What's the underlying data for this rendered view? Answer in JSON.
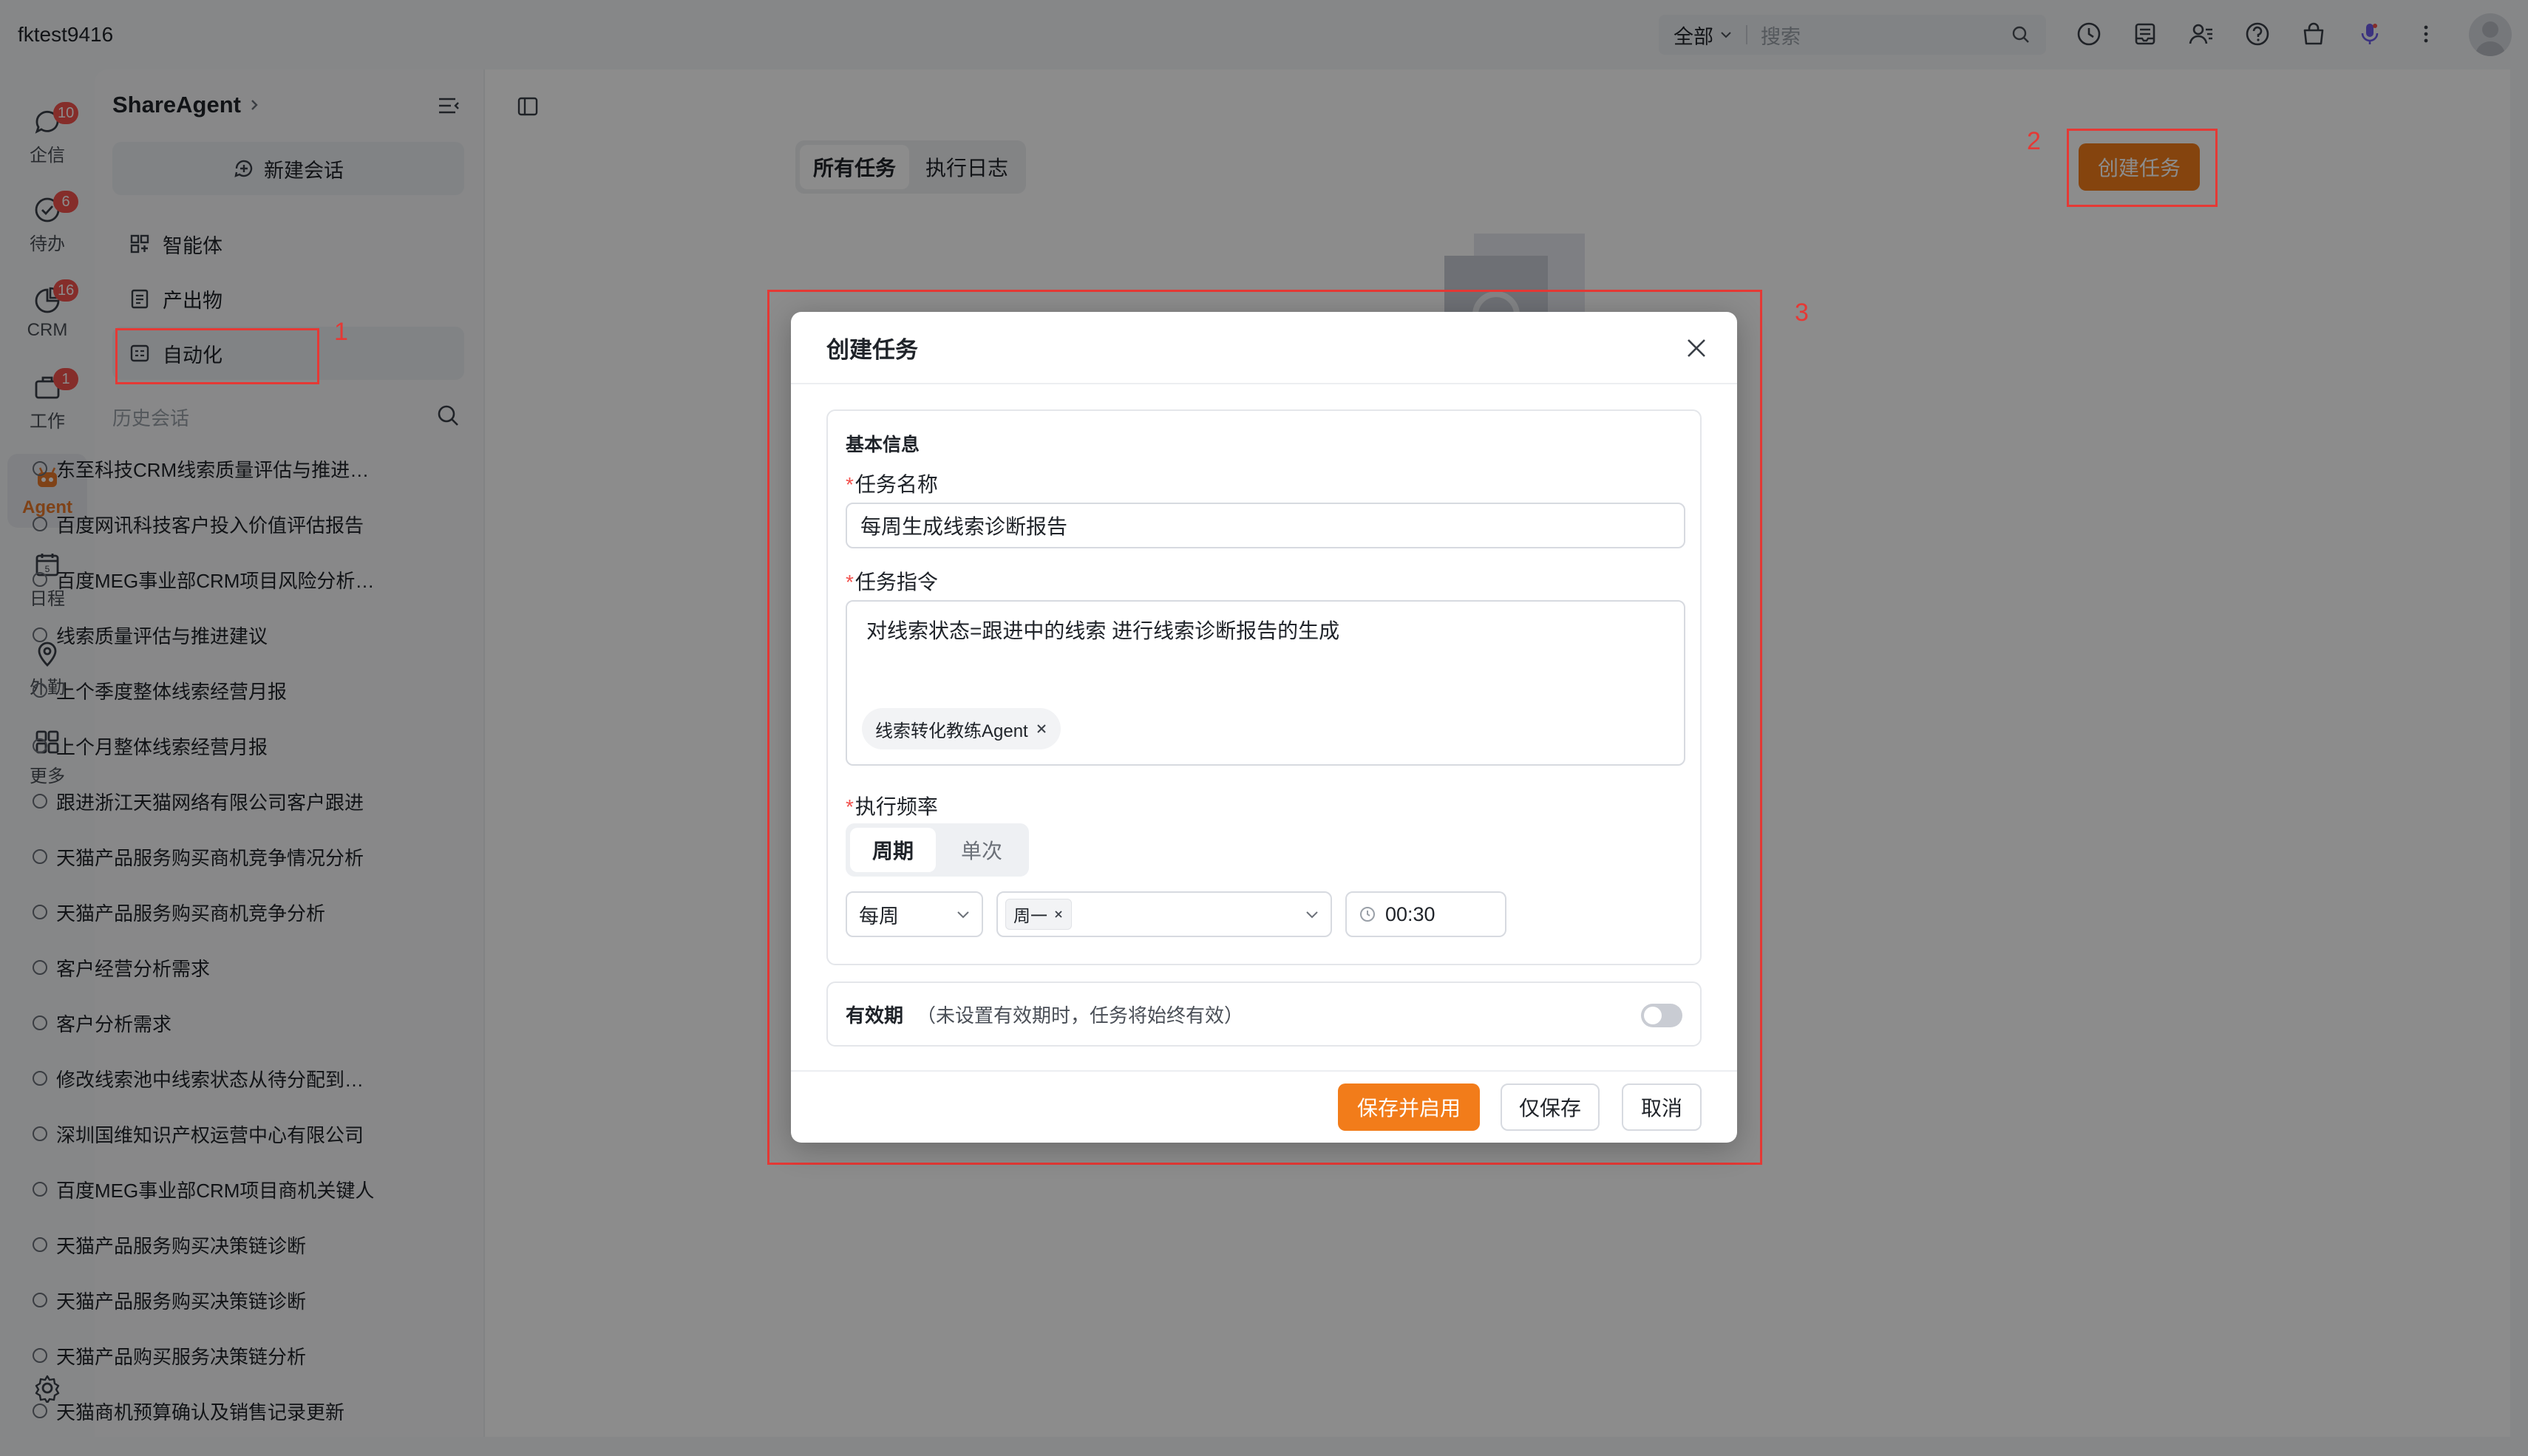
{
  "topbar": {
    "account": "fktest9416",
    "search_scope": "全部",
    "search_placeholder": "搜索"
  },
  "rail": {
    "items": [
      {
        "label": "企信",
        "badge": "10",
        "icon": "chat-icon"
      },
      {
        "label": "待办",
        "badge": "6",
        "icon": "check-circle-icon"
      },
      {
        "label": "CRM",
        "badge": "16",
        "icon": "pie-chart-icon"
      },
      {
        "label": "工作",
        "badge": "1",
        "icon": "briefcase-icon"
      },
      {
        "label": "Agent",
        "badge": "",
        "icon": "robot-icon"
      },
      {
        "label": "日程",
        "badge": "",
        "icon": "calendar-icon"
      },
      {
        "label": "外勤",
        "badge": "",
        "icon": "location-pin-icon"
      },
      {
        "label": "更多",
        "badge": "",
        "icon": "grid-icon"
      }
    ]
  },
  "sidebar": {
    "app_name": "ShareAgent",
    "new_chat": "新建会话",
    "nav": [
      {
        "label": "智能体",
        "icon": "agent-grid-icon"
      },
      {
        "label": "产出物",
        "icon": "document-icon"
      },
      {
        "label": "自动化",
        "icon": "automation-icon"
      }
    ],
    "history_title": "历史会话",
    "history": [
      "东至科技CRM线索质量评估与推进建议",
      "百度网讯科技客户投入价值评估报告",
      "百度MEG事业部CRM项目风险分析报告",
      "线索质量评估与推进建议",
      "上个季度整体线索经营月报",
      "上个月整体线索经营月报",
      "跟进浙江天猫网络有限公司客户跟进",
      "天猫产品服务购买商机竞争情况分析",
      "天猫产品服务购买商机竞争分析",
      "客户经营分析需求",
      "客户分析需求",
      "修改线索池中线索状态从待分配到已分配",
      "深圳国维知识产权运营中心有限公司",
      "百度MEG事业部CRM项目商机关键人",
      "天猫产品服务购买决策链诊断",
      "天猫产品服务购买决策链诊断",
      "天猫产品购买服务决策链分析",
      "天猫商机预算确认及销售记录更新"
    ]
  },
  "main": {
    "tabs": [
      "所有任务",
      "执行日志"
    ],
    "create_button": "创建任务"
  },
  "annotations": {
    "one": "1",
    "two": "2",
    "three": "3"
  },
  "modal": {
    "title": "创建任务",
    "section_basic": "基本信息",
    "name_label": "任务名称",
    "name_value": "每周生成线索诊断报告",
    "instruction_label": "任务指令",
    "instruction_value": "对线索状态=跟进中的线索 进行线索诊断报告的生成",
    "agent_chip": "线索转化教练Agent",
    "frequency_label": "执行频率",
    "frequency_options": [
      "周期",
      "单次"
    ],
    "period_value": "每周",
    "weekday_tag": "周一",
    "time_value": "00:30",
    "validity_label": "有效期",
    "validity_hint": "（未设置有效期时，任务将始终有效）",
    "validity_enabled": false,
    "buttons": {
      "save_enable": "保存并启用",
      "save_only": "仅保存",
      "cancel": "取消"
    }
  },
  "colors": {
    "accent": "#f27c1a",
    "annotation": "#e53935",
    "badge": "#f2524e"
  }
}
